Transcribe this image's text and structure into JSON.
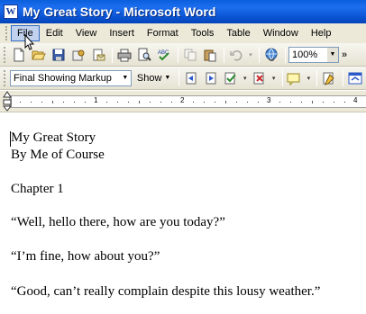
{
  "window": {
    "title": "My Great Story - Microsoft Word",
    "app_icon_letter": "W"
  },
  "menu": {
    "items": [
      "File",
      "Edit",
      "View",
      "Insert",
      "Format",
      "Tools",
      "Table",
      "Window",
      "Help"
    ],
    "active": "File"
  },
  "standard_toolbar": {
    "buttons": [
      "new-document-icon",
      "open-icon",
      "save-icon",
      "permission-icon",
      "email-icon",
      "print-icon",
      "print-preview-icon",
      "spelling-icon",
      "copy-icon",
      "paste-icon",
      "undo-icon",
      "insert-hyperlink-icon"
    ],
    "zoom": "100%",
    "overflow": "»"
  },
  "reviewing_toolbar": {
    "display_for_review": "Final Showing Markup",
    "show_label": "Show",
    "buttons": [
      "previous-change-icon",
      "next-change-icon",
      "accept-change-icon",
      "reject-change-icon",
      "insert-comment-icon",
      "track-changes-icon",
      "reviewing-pane-icon"
    ]
  },
  "ruler": {
    "numbers": [
      "1",
      "2",
      "3",
      "4"
    ]
  },
  "document": {
    "lines": [
      "My Great Story",
      "By Me of Course",
      "Chapter 1",
      "“Well, hello there, how are you today?”",
      "“I’m fine, how about you?”",
      "“Good, can’t really complain despite this lousy weather.”"
    ]
  },
  "colors": {
    "titlebar": "#0a5fdc",
    "menubar": "#ece9d8",
    "active_menu": "#c1d2ee"
  }
}
